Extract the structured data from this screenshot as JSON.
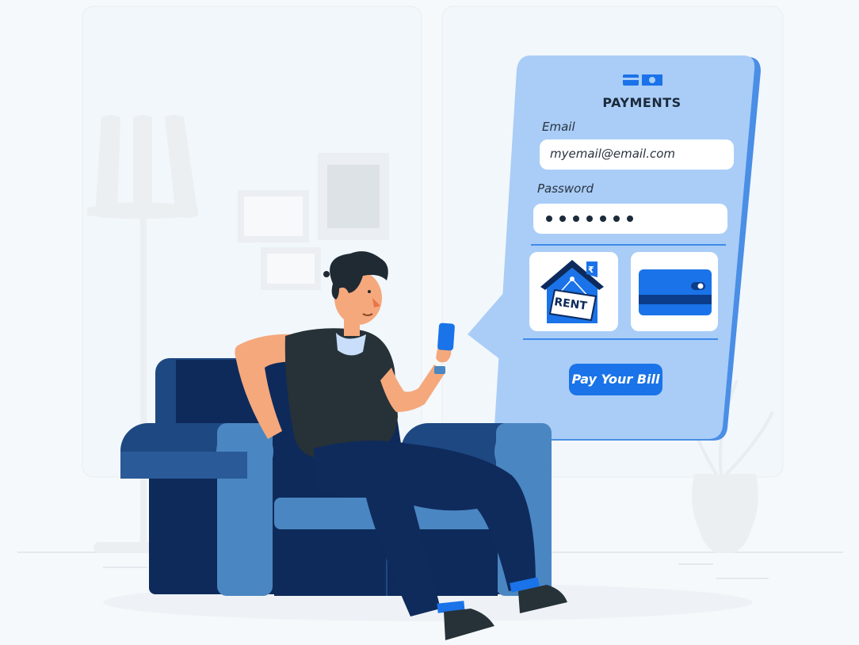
{
  "payment_card": {
    "title": "PAYMENTS",
    "header_icon": "wallet-cash-icon",
    "email": {
      "label": "Email",
      "value": "myemail@email.com"
    },
    "password": {
      "label": "Password",
      "masked_dots": 7
    },
    "options": [
      {
        "name": "rent-option",
        "icon": "house-rent-sign-icon",
        "sign_text": "RENT",
        "currency_symbol": "₹"
      },
      {
        "name": "card-option",
        "icon": "credit-card-icon"
      }
    ],
    "button_label": "Pay Your Bill"
  },
  "colors": {
    "accent": "#1a73e8",
    "card_bg": "#a9cdf7",
    "sofa_dark": "#1e4882",
    "sofa_light": "#4a86c2",
    "background": "#f5f9fc"
  }
}
